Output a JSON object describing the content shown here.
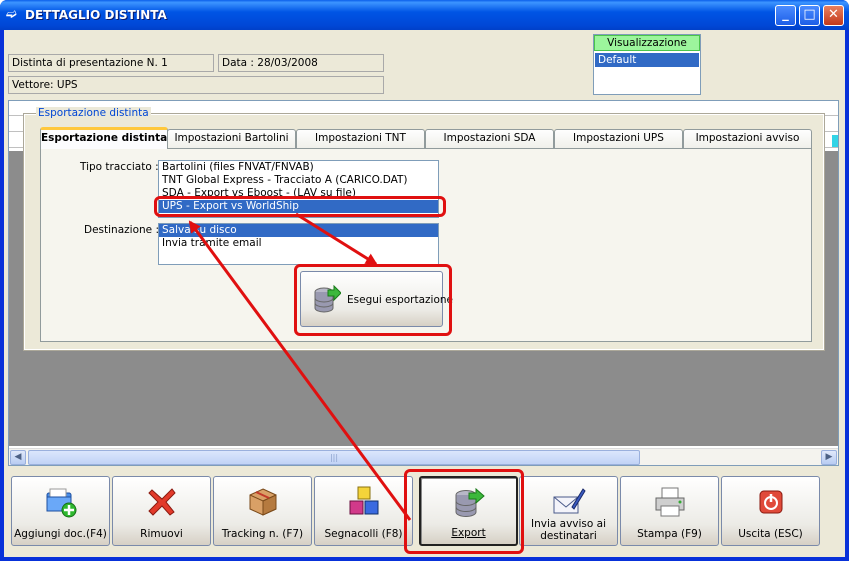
{
  "window": {
    "title": "DETTAGLIO DISTINTA",
    "controls": {
      "minimize": "_",
      "maximize": "□",
      "close": "✕"
    }
  },
  "header": {
    "distinta_label": "Distinta di presentazione N. 1",
    "data_label": "Data : 28/03/2008",
    "vettore_label": "Vettore: UPS"
  },
  "visualizzazione": {
    "title": "Visualizzazione",
    "selected": "Default"
  },
  "export_panel": {
    "legend": "Esportazione distinta",
    "tabs": [
      {
        "label": "Esportazione distinta",
        "active": true
      },
      {
        "label": "Impostazioni Bartolini",
        "active": false
      },
      {
        "label": "Impostazioni TNT",
        "active": false
      },
      {
        "label": "Impostazioni SDA",
        "active": false
      },
      {
        "label": "Impostazioni UPS",
        "active": false
      },
      {
        "label": "Impostazioni avviso",
        "active": false
      }
    ],
    "tipo_tracciato_label": "Tipo tracciato :",
    "tipo_tracciato_items": [
      "Bartolini (files FNVAT/FNVAB)",
      "TNT Global Express - Tracciato A (CARICO.DAT)",
      "SDA - Export vs Eboost - (LAV su file)",
      "UPS - Export vs WorldShip"
    ],
    "tipo_tracciato_selected": "UPS - Export vs WorldShip",
    "destinazione_label": "Destinazione :",
    "destinazione_items": [
      "Salva su disco",
      "Invia tramite email"
    ],
    "destinazione_selected": "Salva su disco",
    "execute_button": "Esegui esportazione"
  },
  "toolbar": [
    {
      "label": "Aggiungi doc.(F4)",
      "icon": "folder-add-icon"
    },
    {
      "label": "Rimuovi",
      "icon": "red-x-icon"
    },
    {
      "label": "Tracking n. (F7)",
      "icon": "package-icon"
    },
    {
      "label": "Segnacolli (F8)",
      "icon": "blocks-icon"
    },
    {
      "label": "Export",
      "icon": "database-export-icon"
    },
    {
      "label": "Invia avviso ai destinatari",
      "icon": "envelope-pen-icon"
    },
    {
      "label": "Stampa (F9)",
      "icon": "printer-icon"
    },
    {
      "label": "Uscita (ESC)",
      "icon": "power-icon"
    }
  ],
  "colors": {
    "highlight": "#E01010",
    "selection": "#316AC5",
    "titlebar": "#0055E5"
  }
}
